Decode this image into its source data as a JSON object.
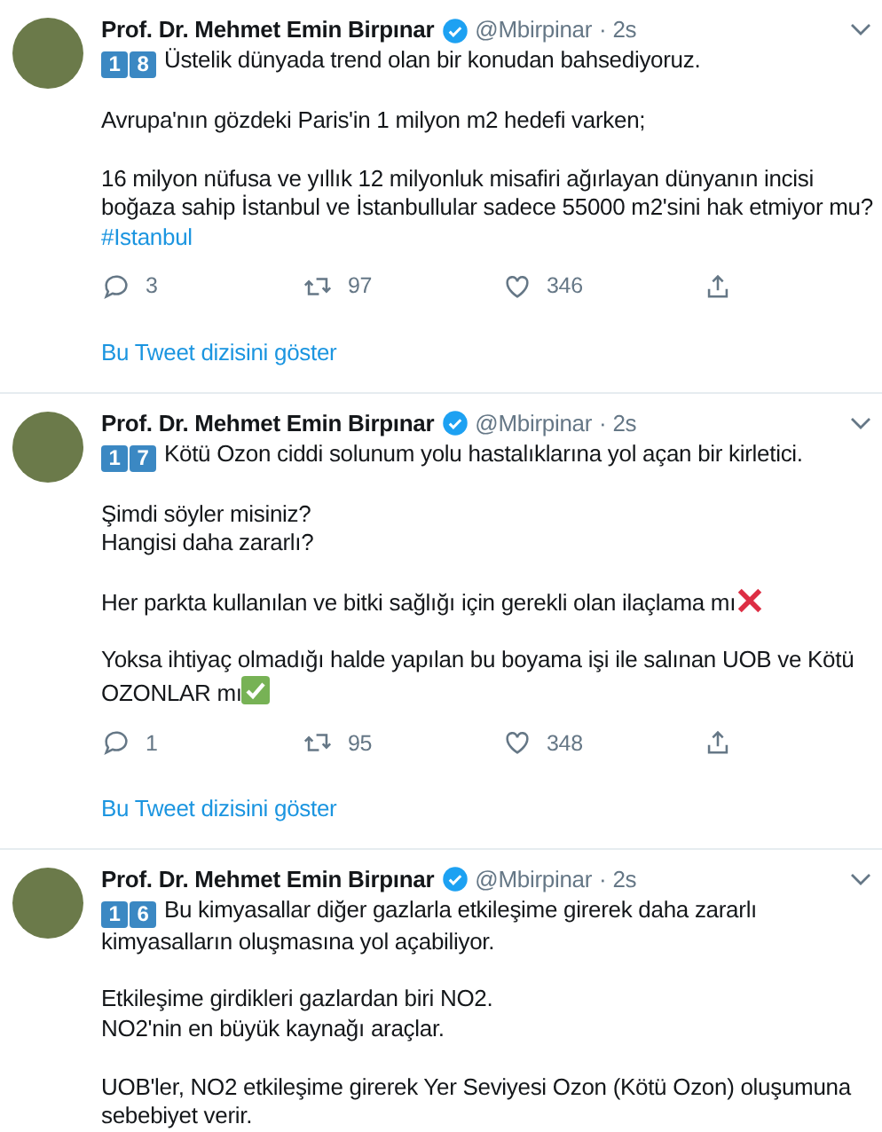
{
  "tweets": [
    {
      "name": "Prof. Dr. Mehmet Emin Birpınar",
      "verified": true,
      "handle": "@Mbirpinar",
      "time": "· 2s",
      "number_badges": [
        "1",
        "8"
      ],
      "paragraphs": [
        {
          "kind": "text",
          "lines": [
            "Üstelik dünyada trend olan bir konudan bahsediyoruz."
          ]
        },
        {
          "kind": "text",
          "lines": [
            "Avrupa'nın gözdeki Paris'in 1 milyon m2 hedefi varken;"
          ]
        },
        {
          "kind": "text",
          "lines": [
            "16 milyon nüfusa ve yıllık 12 milyonluk misafiri ağırlayan dünyanın incisi",
            "boğaza sahip İstanbul ve İstanbullular sadece 55000 m2'sini hak etmiyor mu?"
          ]
        },
        {
          "kind": "hashtag",
          "lines": [
            "#Istanbul"
          ]
        }
      ],
      "stats": {
        "replies": "3",
        "retweets": "97",
        "likes": "346"
      },
      "show_thread": "Bu Tweet dizisini göster"
    },
    {
      "name": "Prof. Dr. Mehmet Emin Birpınar",
      "verified": true,
      "handle": "@Mbirpinar",
      "time": "· 2s",
      "number_badges": [
        "1",
        "7"
      ],
      "paragraphs": [
        {
          "kind": "text",
          "lines": [
            "Kötü Ozon ciddi solunum yolu hastalıklarına yol açan bir kirletici."
          ]
        },
        {
          "kind": "text",
          "lines": [
            "Şimdi söyler misiniz?",
            "Hangisi daha zararlı?"
          ]
        },
        {
          "kind": "crossed",
          "lines": [
            "Her parkta kullanılan ve bitki sağlığı için gerekli olan ilaçlama mı"
          ]
        },
        {
          "kind": "checked",
          "lines": [
            "Yoksa ihtiyaç olmadığı halde yapılan bu boyama işi ile salınan UOB ve Kötü",
            "OZONLAR mı"
          ]
        }
      ],
      "stats": {
        "replies": "1",
        "retweets": "95",
        "likes": "348"
      },
      "show_thread": "Bu Tweet dizisini göster"
    },
    {
      "name": "Prof. Dr. Mehmet Emin Birpınar",
      "verified": true,
      "handle": "@Mbirpinar",
      "time": "· 2s",
      "number_badges": [
        "1",
        "6"
      ],
      "paragraphs": [
        {
          "kind": "text",
          "lines": [
            "Bu kimyasallar diğer gazlarla etkileşime girerek daha zararlı",
            "kimyasalların oluşmasına yol açabiliyor."
          ]
        },
        {
          "kind": "text",
          "lines": [
            "Etkileşime girdikleri gazlardan biri NO2.",
            "NO2'nin en büyük kaynağı araçlar."
          ]
        },
        {
          "kind": "text",
          "lines": [
            "UOB'ler, NO2 etkileşime girerek Yer Seviyesi Ozon (Kötü Ozon) oluşumuna",
            "sebebiyet verir."
          ]
        }
      ]
    }
  ]
}
